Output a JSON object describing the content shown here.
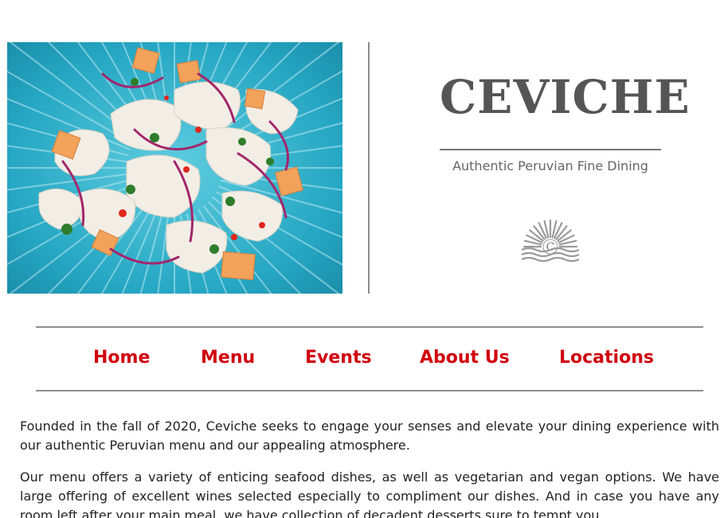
{
  "brand": {
    "title": "CEVICHE",
    "tagline": "Authentic Peruvian Fine Dining",
    "logo_letter": "C"
  },
  "nav": {
    "items": [
      {
        "label": "Home"
      },
      {
        "label": "Menu"
      },
      {
        "label": "Events"
      },
      {
        "label": "About Us"
      },
      {
        "label": "Locations"
      }
    ]
  },
  "content": {
    "paragraphs": [
      "Founded in the fall of 2020, Ceviche seeks to engage your senses and elevate your dining experience with our authentic Peruvian menu and our appealing atmosphere.",
      "Our menu offers a variety of enticing seafood dishes, as well as vegetarian and vegan options. We have large offering of excellent wines selected especially to compliment our dishes. And in case you have any room left after your main meal, we have collection of decadent desserts sure to tempt you."
    ]
  },
  "colors": {
    "nav_link": "#d0000e",
    "title": "#555555",
    "plate": "#2aa9c4"
  },
  "icons": {
    "logo": "sunrise-over-waves-icon"
  }
}
